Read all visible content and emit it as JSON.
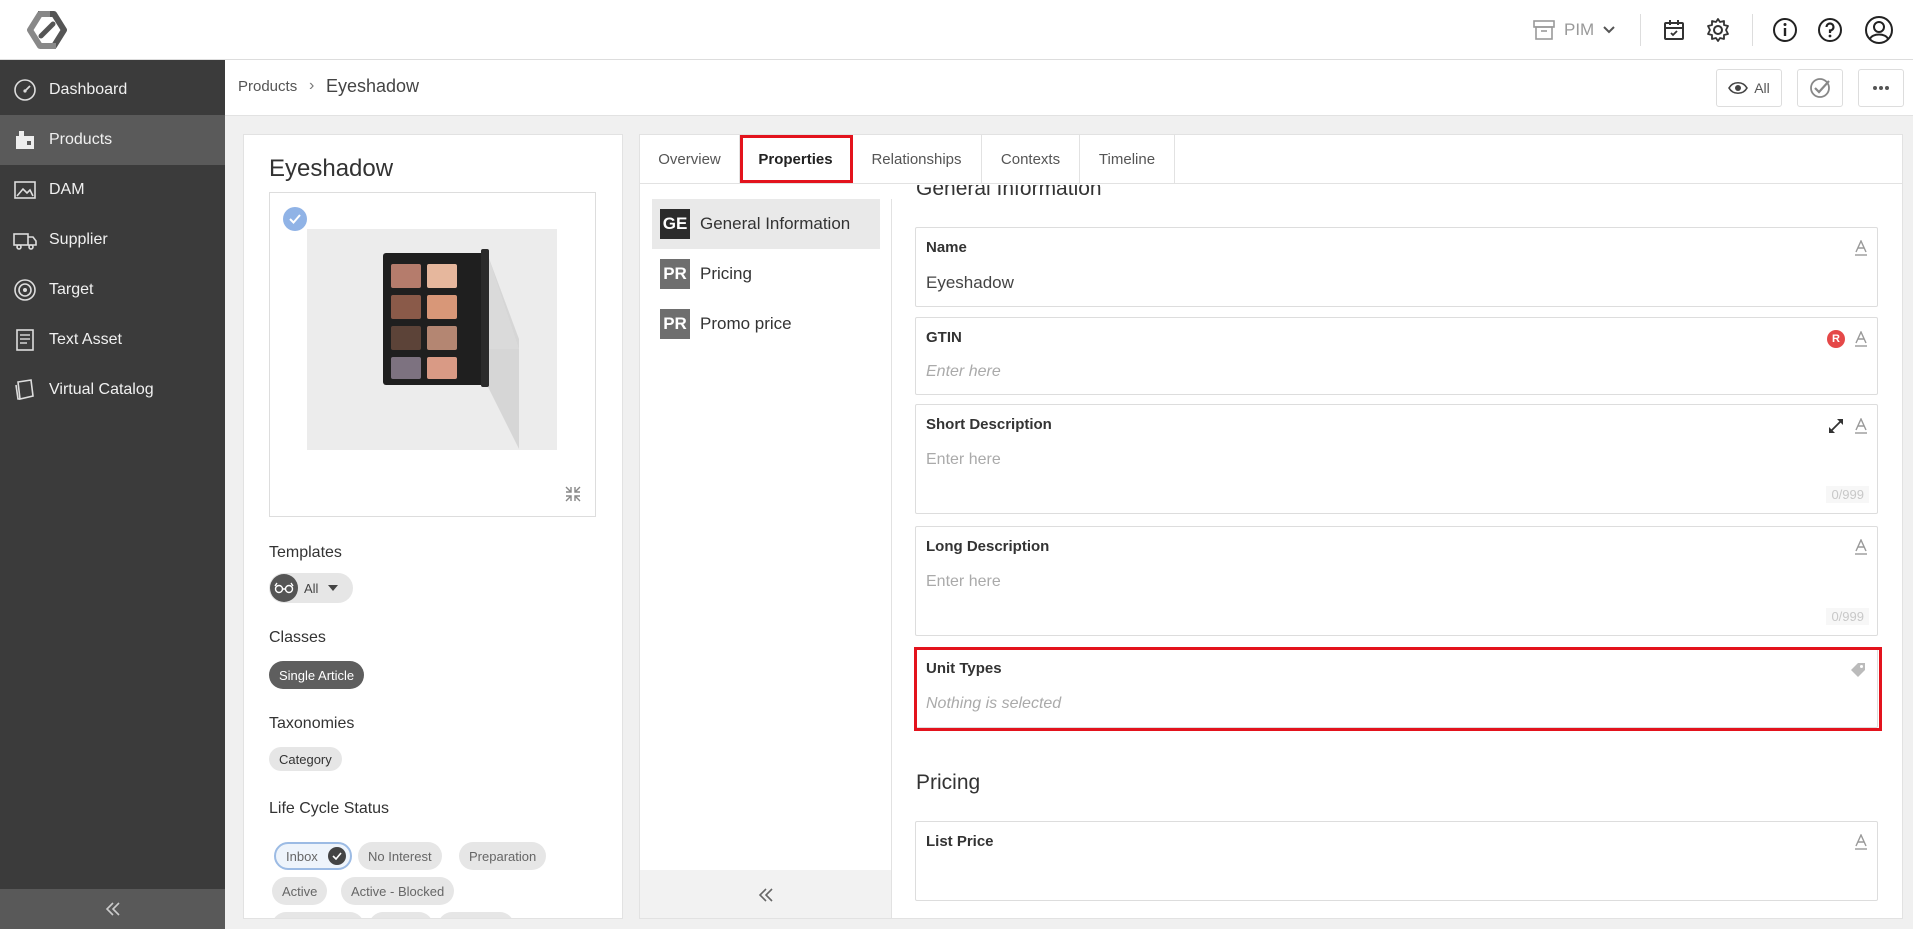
{
  "topbar": {
    "app_switch_label": "PIM",
    "icons": [
      "logo-icon",
      "archive-icon",
      "calendar-icon",
      "gear-icon",
      "info-icon",
      "help-icon",
      "user-icon"
    ]
  },
  "sidebar": {
    "items": [
      {
        "label": "Dashboard",
        "icon": "dashboard-icon",
        "active": false
      },
      {
        "label": "Products",
        "icon": "products-icon",
        "active": true
      },
      {
        "label": "DAM",
        "icon": "dam-icon",
        "active": false
      },
      {
        "label": "Supplier",
        "icon": "truck-icon",
        "active": false
      },
      {
        "label": "Target",
        "icon": "target-icon",
        "active": false
      },
      {
        "label": "Text Asset",
        "icon": "text-asset-icon",
        "active": false
      },
      {
        "label": "Virtual Catalog",
        "icon": "catalog-icon",
        "active": false
      }
    ]
  },
  "header": {
    "breadcrumb_root": "Products",
    "breadcrumb_sep": "›",
    "breadcrumb_current": "Eyeshadow",
    "view_label": "All"
  },
  "product": {
    "title": "Eyeshadow",
    "templates_label": "Templates",
    "templates_value": "All",
    "classes_label": "Classes",
    "class_chip": "Single Article",
    "taxonomies_label": "Taxonomies",
    "taxonomy_chip": "Category",
    "lifecycle_label": "Life Cycle Status",
    "lifecycle_chips": [
      "Inbox",
      "No Interest",
      "Preparation",
      "Active",
      "Active - Blocked"
    ]
  },
  "tabs": [
    "Overview",
    "Properties",
    "Relationships",
    "Contexts",
    "Timeline"
  ],
  "active_tab": "Properties",
  "groups": [
    {
      "badge": "GE",
      "label": "General Information",
      "color": "#2b2b2b"
    },
    {
      "badge": "PR",
      "label": "Pricing",
      "color": "#6e6e6e"
    },
    {
      "badge": "PR",
      "label": "Promo price",
      "color": "#6e6e6e"
    }
  ],
  "sections": {
    "general": "General Information",
    "pricing": "Pricing"
  },
  "fields": {
    "name": {
      "label": "Name",
      "value": "Eyeshadow"
    },
    "gtin": {
      "label": "GTIN",
      "placeholder": "Enter here",
      "required_badge": "R"
    },
    "short_desc": {
      "label": "Short Description",
      "placeholder": "Enter here",
      "counter": "0/999"
    },
    "long_desc": {
      "label": "Long Description",
      "placeholder": "Enter here",
      "counter": "0/999"
    },
    "unit_types": {
      "label": "Unit Types",
      "placeholder": "Nothing is selected"
    },
    "list_price": {
      "label": "List Price"
    }
  },
  "colors": {
    "sidebar_bg": "#3b3b3b",
    "sidebar_active": "#5a5a5a",
    "highlight_red": "#e3131d",
    "required_red": "#e54848",
    "check_blue": "#90b3e6"
  }
}
